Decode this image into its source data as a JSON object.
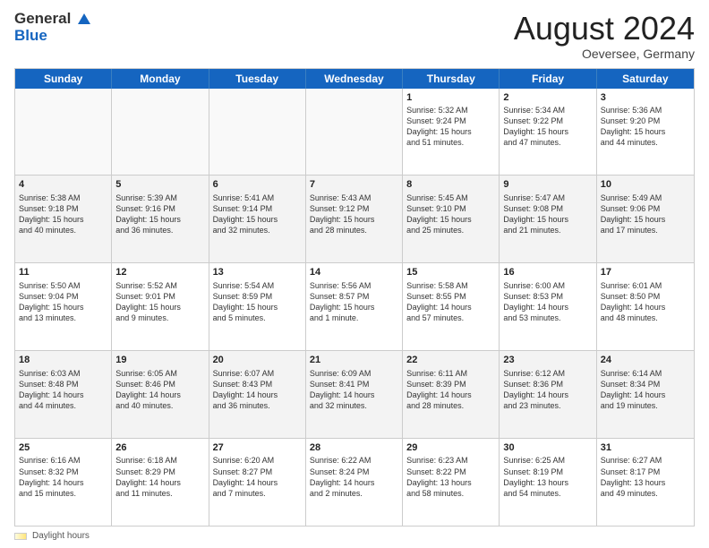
{
  "logo": {
    "general": "General",
    "blue": "Blue"
  },
  "title": "August 2024",
  "location": "Oeversee, Germany",
  "weekdays": [
    "Sunday",
    "Monday",
    "Tuesday",
    "Wednesday",
    "Thursday",
    "Friday",
    "Saturday"
  ],
  "footer_label": "Daylight hours",
  "rows": [
    [
      {
        "num": "",
        "info": "",
        "empty": true
      },
      {
        "num": "",
        "info": "",
        "empty": true
      },
      {
        "num": "",
        "info": "",
        "empty": true
      },
      {
        "num": "",
        "info": "",
        "empty": true
      },
      {
        "num": "1",
        "info": "Sunrise: 5:32 AM\nSunset: 9:24 PM\nDaylight: 15 hours\nand 51 minutes.",
        "empty": false
      },
      {
        "num": "2",
        "info": "Sunrise: 5:34 AM\nSunset: 9:22 PM\nDaylight: 15 hours\nand 47 minutes.",
        "empty": false
      },
      {
        "num": "3",
        "info": "Sunrise: 5:36 AM\nSunset: 9:20 PM\nDaylight: 15 hours\nand 44 minutes.",
        "empty": false
      }
    ],
    [
      {
        "num": "4",
        "info": "Sunrise: 5:38 AM\nSunset: 9:18 PM\nDaylight: 15 hours\nand 40 minutes.",
        "empty": false
      },
      {
        "num": "5",
        "info": "Sunrise: 5:39 AM\nSunset: 9:16 PM\nDaylight: 15 hours\nand 36 minutes.",
        "empty": false
      },
      {
        "num": "6",
        "info": "Sunrise: 5:41 AM\nSunset: 9:14 PM\nDaylight: 15 hours\nand 32 minutes.",
        "empty": false
      },
      {
        "num": "7",
        "info": "Sunrise: 5:43 AM\nSunset: 9:12 PM\nDaylight: 15 hours\nand 28 minutes.",
        "empty": false
      },
      {
        "num": "8",
        "info": "Sunrise: 5:45 AM\nSunset: 9:10 PM\nDaylight: 15 hours\nand 25 minutes.",
        "empty": false
      },
      {
        "num": "9",
        "info": "Sunrise: 5:47 AM\nSunset: 9:08 PM\nDaylight: 15 hours\nand 21 minutes.",
        "empty": false
      },
      {
        "num": "10",
        "info": "Sunrise: 5:49 AM\nSunset: 9:06 PM\nDaylight: 15 hours\nand 17 minutes.",
        "empty": false
      }
    ],
    [
      {
        "num": "11",
        "info": "Sunrise: 5:50 AM\nSunset: 9:04 PM\nDaylight: 15 hours\nand 13 minutes.",
        "empty": false
      },
      {
        "num": "12",
        "info": "Sunrise: 5:52 AM\nSunset: 9:01 PM\nDaylight: 15 hours\nand 9 minutes.",
        "empty": false
      },
      {
        "num": "13",
        "info": "Sunrise: 5:54 AM\nSunset: 8:59 PM\nDaylight: 15 hours\nand 5 minutes.",
        "empty": false
      },
      {
        "num": "14",
        "info": "Sunrise: 5:56 AM\nSunset: 8:57 PM\nDaylight: 15 hours\nand 1 minute.",
        "empty": false
      },
      {
        "num": "15",
        "info": "Sunrise: 5:58 AM\nSunset: 8:55 PM\nDaylight: 14 hours\nand 57 minutes.",
        "empty": false
      },
      {
        "num": "16",
        "info": "Sunrise: 6:00 AM\nSunset: 8:53 PM\nDaylight: 14 hours\nand 53 minutes.",
        "empty": false
      },
      {
        "num": "17",
        "info": "Sunrise: 6:01 AM\nSunset: 8:50 PM\nDaylight: 14 hours\nand 48 minutes.",
        "empty": false
      }
    ],
    [
      {
        "num": "18",
        "info": "Sunrise: 6:03 AM\nSunset: 8:48 PM\nDaylight: 14 hours\nand 44 minutes.",
        "empty": false
      },
      {
        "num": "19",
        "info": "Sunrise: 6:05 AM\nSunset: 8:46 PM\nDaylight: 14 hours\nand 40 minutes.",
        "empty": false
      },
      {
        "num": "20",
        "info": "Sunrise: 6:07 AM\nSunset: 8:43 PM\nDaylight: 14 hours\nand 36 minutes.",
        "empty": false
      },
      {
        "num": "21",
        "info": "Sunrise: 6:09 AM\nSunset: 8:41 PM\nDaylight: 14 hours\nand 32 minutes.",
        "empty": false
      },
      {
        "num": "22",
        "info": "Sunrise: 6:11 AM\nSunset: 8:39 PM\nDaylight: 14 hours\nand 28 minutes.",
        "empty": false
      },
      {
        "num": "23",
        "info": "Sunrise: 6:12 AM\nSunset: 8:36 PM\nDaylight: 14 hours\nand 23 minutes.",
        "empty": false
      },
      {
        "num": "24",
        "info": "Sunrise: 6:14 AM\nSunset: 8:34 PM\nDaylight: 14 hours\nand 19 minutes.",
        "empty": false
      }
    ],
    [
      {
        "num": "25",
        "info": "Sunrise: 6:16 AM\nSunset: 8:32 PM\nDaylight: 14 hours\nand 15 minutes.",
        "empty": false
      },
      {
        "num": "26",
        "info": "Sunrise: 6:18 AM\nSunset: 8:29 PM\nDaylight: 14 hours\nand 11 minutes.",
        "empty": false
      },
      {
        "num": "27",
        "info": "Sunrise: 6:20 AM\nSunset: 8:27 PM\nDaylight: 14 hours\nand 7 minutes.",
        "empty": false
      },
      {
        "num": "28",
        "info": "Sunrise: 6:22 AM\nSunset: 8:24 PM\nDaylight: 14 hours\nand 2 minutes.",
        "empty": false
      },
      {
        "num": "29",
        "info": "Sunrise: 6:23 AM\nSunset: 8:22 PM\nDaylight: 13 hours\nand 58 minutes.",
        "empty": false
      },
      {
        "num": "30",
        "info": "Sunrise: 6:25 AM\nSunset: 8:19 PM\nDaylight: 13 hours\nand 54 minutes.",
        "empty": false
      },
      {
        "num": "31",
        "info": "Sunrise: 6:27 AM\nSunset: 8:17 PM\nDaylight: 13 hours\nand 49 minutes.",
        "empty": false
      }
    ]
  ]
}
